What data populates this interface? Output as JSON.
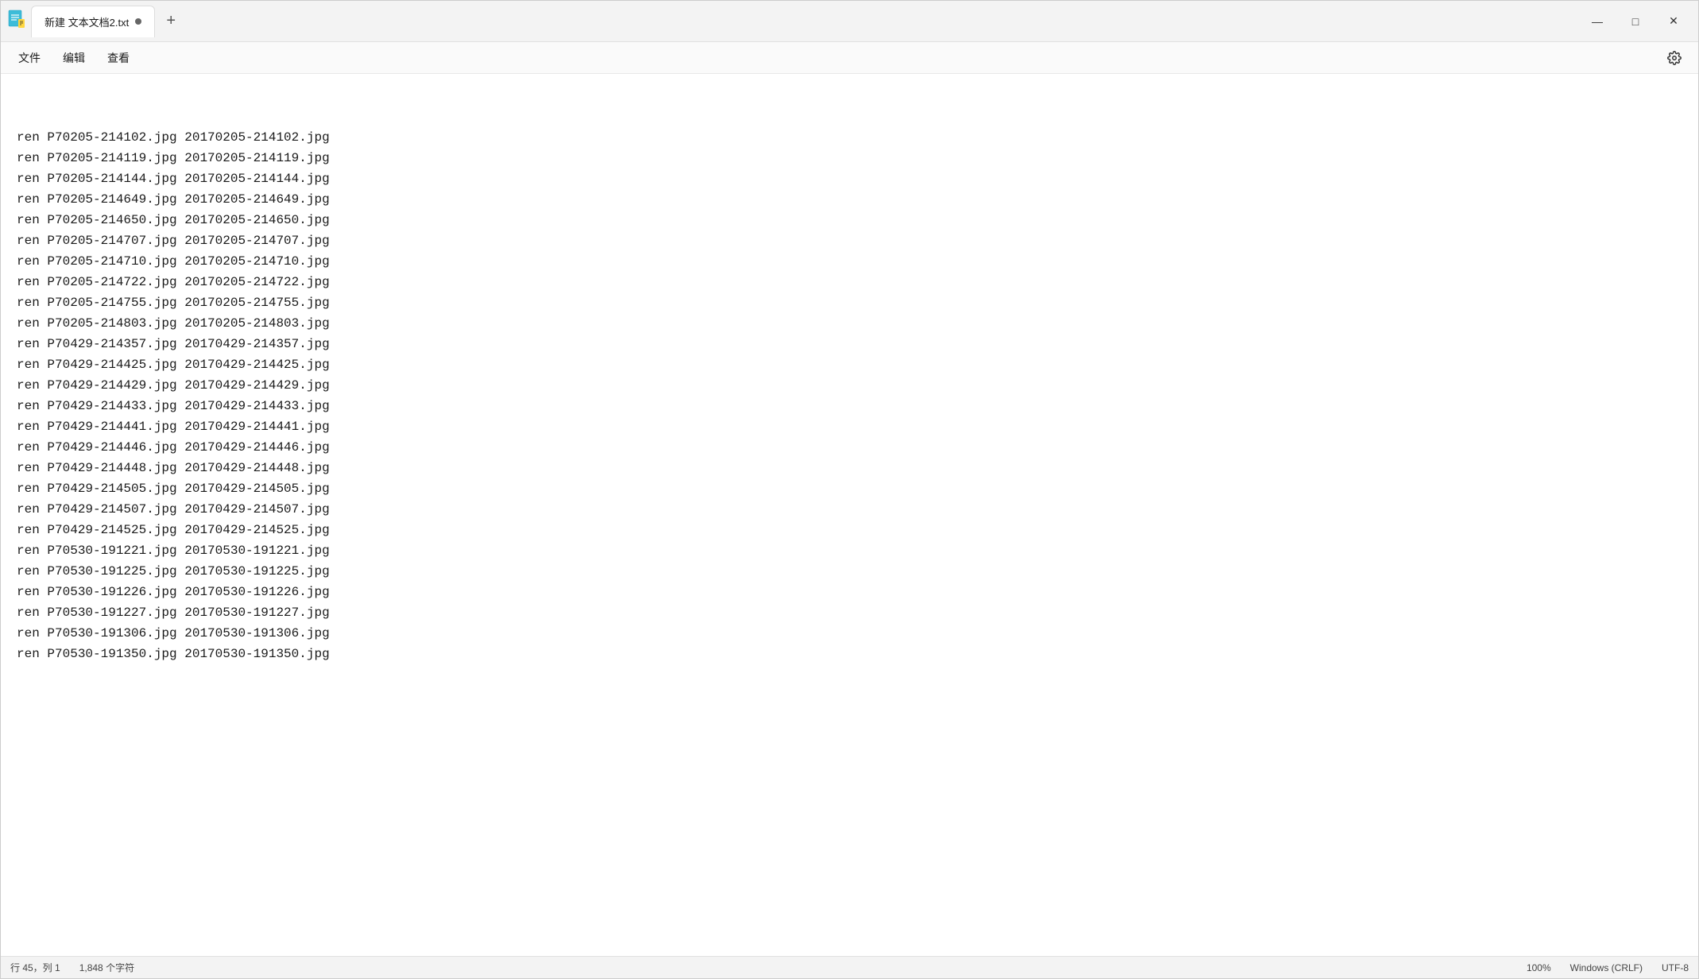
{
  "window": {
    "title": "新建 文本文档2.txt",
    "app_icon": "notepad"
  },
  "tab": {
    "title": "新建 文本文档2.txt",
    "unsaved_dot": "●",
    "add_label": "+"
  },
  "window_controls": {
    "minimize": "—",
    "maximize": "□",
    "close": "✕"
  },
  "menu": {
    "file": "文件",
    "edit": "编辑",
    "view": "查看"
  },
  "lines": [
    "ren P70205-214102.jpg 20170205-214102.jpg",
    "ren P70205-214119.jpg 20170205-214119.jpg",
    "ren P70205-214144.jpg 20170205-214144.jpg",
    "ren P70205-214649.jpg 20170205-214649.jpg",
    "ren P70205-214650.jpg 20170205-214650.jpg",
    "ren P70205-214707.jpg 20170205-214707.jpg",
    "ren P70205-214710.jpg 20170205-214710.jpg",
    "ren P70205-214722.jpg 20170205-214722.jpg",
    "ren P70205-214755.jpg 20170205-214755.jpg",
    "ren P70205-214803.jpg 20170205-214803.jpg",
    "ren P70429-214357.jpg 20170429-214357.jpg",
    "ren P70429-214425.jpg 20170429-214425.jpg",
    "ren P70429-214429.jpg 20170429-214429.jpg",
    "ren P70429-214433.jpg 20170429-214433.jpg",
    "ren P70429-214441.jpg 20170429-214441.jpg",
    "ren P70429-214446.jpg 20170429-214446.jpg",
    "ren P70429-214448.jpg 20170429-214448.jpg",
    "ren P70429-214505.jpg 20170429-214505.jpg",
    "ren P70429-214507.jpg 20170429-214507.jpg",
    "ren P70429-214525.jpg 20170429-214525.jpg",
    "ren P70530-191221.jpg 20170530-191221.jpg",
    "ren P70530-191225.jpg 20170530-191225.jpg",
    "ren P70530-191226.jpg 20170530-191226.jpg",
    "ren P70530-191227.jpg 20170530-191227.jpg",
    "ren P70530-191306.jpg 20170530-191306.jpg",
    "ren P70530-191350.jpg 20170530-191350.jpg"
  ],
  "status_bar": {
    "position": "行 45，列 1",
    "char_count": "1,848 个字符",
    "zoom": "100%",
    "line_ending": "Windows (CRLF)",
    "encoding": "UTF-8"
  }
}
